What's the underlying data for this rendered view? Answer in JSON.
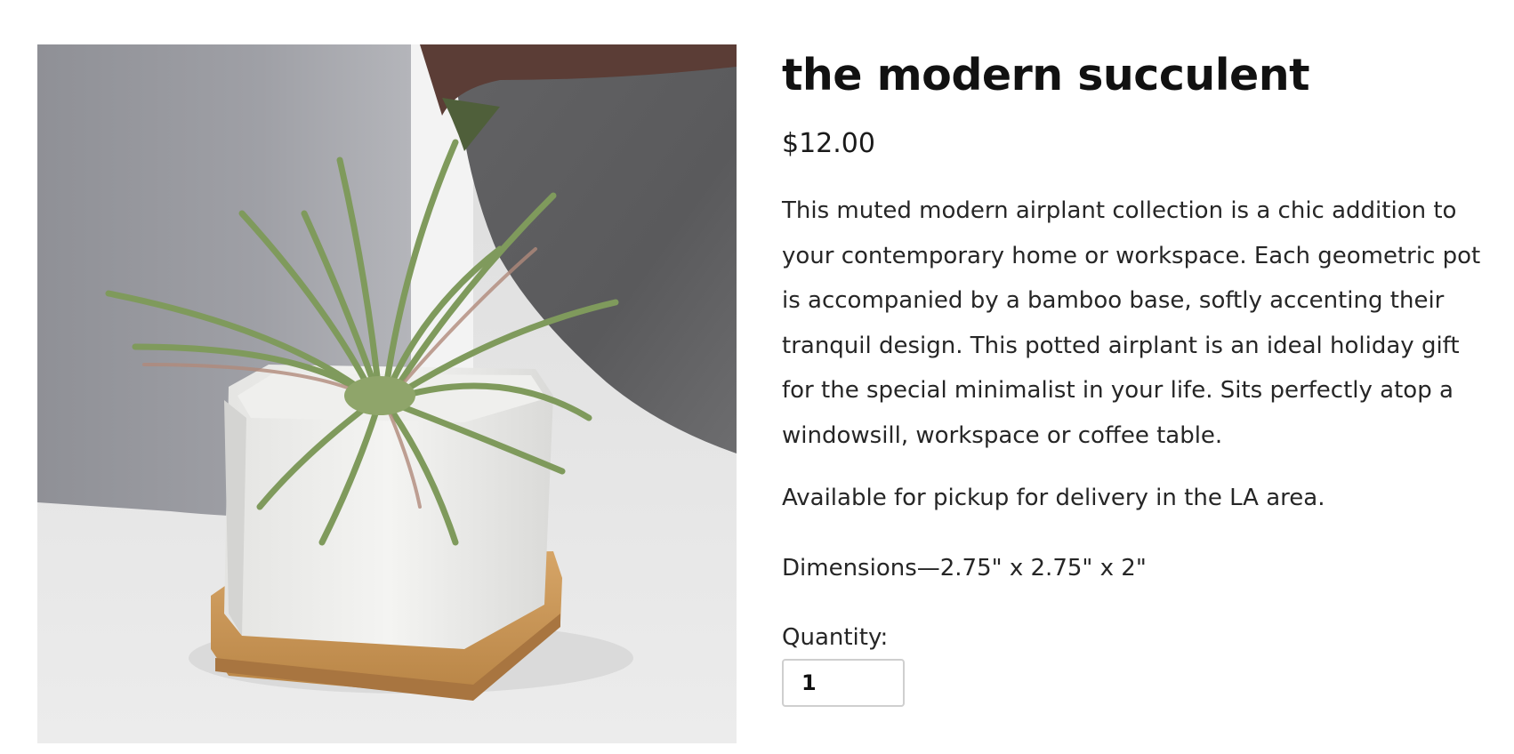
{
  "product": {
    "image_alt": "airplant in white geometric pot on bamboo base",
    "title": "the modern succulent",
    "price": "$12.00",
    "description": "This muted modern airplant collection is a chic addition to your contemporary home or workspace. Each geometric pot is accompanied by a bamboo base, softly accenting their tranquil design. This potted airplant is an ideal holiday gift for the special minimalist in your life. Sits perfectly atop a windowsill, workspace or coffee table.",
    "availability": "Available for pickup for delivery in the LA area.",
    "dimensions": "Dimensions—2.75\" x 2.75\" x 2\"",
    "quantity_label": "Quantity:",
    "quantity_value": "1"
  }
}
